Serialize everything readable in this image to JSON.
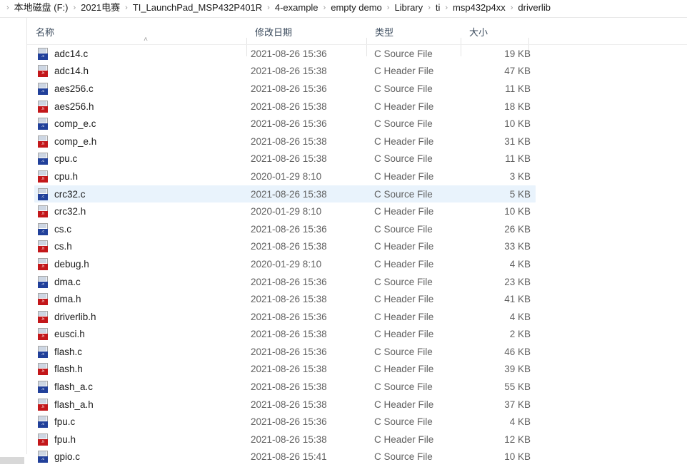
{
  "window": {
    "app": "File Explorer",
    "language": "zh-CN"
  },
  "breadcrumb": {
    "separator": "›",
    "items": [
      "本地磁盘 (F:)",
      "2021电赛",
      "TI_LaunchPad_MSP432P401R",
      "4-example",
      "empty demo",
      "Library",
      "ti",
      "msp432p4xx",
      "driverlib"
    ]
  },
  "columns": {
    "sort_indicator": "˄",
    "sorted_by": "名称",
    "sort_direction": "ascending",
    "headers": [
      {
        "label": "名称",
        "key": "name"
      },
      {
        "label": "修改日期",
        "key": "date"
      },
      {
        "label": "类型",
        "key": "type"
      },
      {
        "label": "大小",
        "key": "size"
      }
    ]
  },
  "colors": {
    "selection": "#e9f3fc",
    "c_source_badge": "#21409a",
    "c_header_badge": "#c3171a",
    "header_text": "#3a4a5c",
    "secondary_text": "#616161"
  },
  "files": [
    {
      "name": "adc14.c",
      "date": "2021-08-26 15:36",
      "type": "C Source File",
      "size": "19 KB",
      "icon": "c-source-file-icon",
      "badge": "c",
      "selected": false
    },
    {
      "name": "adc14.h",
      "date": "2021-08-26 15:38",
      "type": "C Header File",
      "size": "47 KB",
      "icon": "c-header-file-icon",
      "badge": "h",
      "selected": false
    },
    {
      "name": "aes256.c",
      "date": "2021-08-26 15:36",
      "type": "C Source File",
      "size": "11 KB",
      "icon": "c-source-file-icon",
      "badge": "c",
      "selected": false
    },
    {
      "name": "aes256.h",
      "date": "2021-08-26 15:38",
      "type": "C Header File",
      "size": "18 KB",
      "icon": "c-header-file-icon",
      "badge": "h",
      "selected": false
    },
    {
      "name": "comp_e.c",
      "date": "2021-08-26 15:36",
      "type": "C Source File",
      "size": "10 KB",
      "icon": "c-source-file-icon",
      "badge": "c",
      "selected": false
    },
    {
      "name": "comp_e.h",
      "date": "2021-08-26 15:38",
      "type": "C Header File",
      "size": "31 KB",
      "icon": "c-header-file-icon",
      "badge": "h",
      "selected": false
    },
    {
      "name": "cpu.c",
      "date": "2021-08-26 15:38",
      "type": "C Source File",
      "size": "11 KB",
      "icon": "c-source-file-icon",
      "badge": "c",
      "selected": false
    },
    {
      "name": "cpu.h",
      "date": "2020-01-29 8:10",
      "type": "C Header File",
      "size": "3 KB",
      "icon": "c-header-file-icon",
      "badge": "h",
      "selected": false
    },
    {
      "name": "crc32.c",
      "date": "2021-08-26 15:38",
      "type": "C Source File",
      "size": "5 KB",
      "icon": "c-source-file-icon",
      "badge": "c",
      "selected": true
    },
    {
      "name": "crc32.h",
      "date": "2020-01-29 8:10",
      "type": "C Header File",
      "size": "10 KB",
      "icon": "c-header-file-icon",
      "badge": "h",
      "selected": false
    },
    {
      "name": "cs.c",
      "date": "2021-08-26 15:36",
      "type": "C Source File",
      "size": "26 KB",
      "icon": "c-source-file-icon",
      "badge": "c",
      "selected": false
    },
    {
      "name": "cs.h",
      "date": "2021-08-26 15:38",
      "type": "C Header File",
      "size": "33 KB",
      "icon": "c-header-file-icon",
      "badge": "h",
      "selected": false
    },
    {
      "name": "debug.h",
      "date": "2020-01-29 8:10",
      "type": "C Header File",
      "size": "4 KB",
      "icon": "c-header-file-icon",
      "badge": "h",
      "selected": false
    },
    {
      "name": "dma.c",
      "date": "2021-08-26 15:36",
      "type": "C Source File",
      "size": "23 KB",
      "icon": "c-source-file-icon",
      "badge": "c",
      "selected": false
    },
    {
      "name": "dma.h",
      "date": "2021-08-26 15:38",
      "type": "C Header File",
      "size": "41 KB",
      "icon": "c-header-file-icon",
      "badge": "h",
      "selected": false
    },
    {
      "name": "driverlib.h",
      "date": "2021-08-26 15:36",
      "type": "C Header File",
      "size": "4 KB",
      "icon": "c-header-file-icon",
      "badge": "h",
      "selected": false
    },
    {
      "name": "eusci.h",
      "date": "2021-08-26 15:38",
      "type": "C Header File",
      "size": "2 KB",
      "icon": "c-header-file-icon",
      "badge": "h",
      "selected": false
    },
    {
      "name": "flash.c",
      "date": "2021-08-26 15:36",
      "type": "C Source File",
      "size": "46 KB",
      "icon": "c-source-file-icon",
      "badge": "c",
      "selected": false
    },
    {
      "name": "flash.h",
      "date": "2021-08-26 15:38",
      "type": "C Header File",
      "size": "39 KB",
      "icon": "c-header-file-icon",
      "badge": "h",
      "selected": false
    },
    {
      "name": "flash_a.c",
      "date": "2021-08-26 15:38",
      "type": "C Source File",
      "size": "55 KB",
      "icon": "c-source-file-icon",
      "badge": "c",
      "selected": false
    },
    {
      "name": "flash_a.h",
      "date": "2021-08-26 15:38",
      "type": "C Header File",
      "size": "37 KB",
      "icon": "c-header-file-icon",
      "badge": "h",
      "selected": false
    },
    {
      "name": "fpu.c",
      "date": "2021-08-26 15:36",
      "type": "C Source File",
      "size": "4 KB",
      "icon": "c-source-file-icon",
      "badge": "c",
      "selected": false
    },
    {
      "name": "fpu.h",
      "date": "2021-08-26 15:38",
      "type": "C Header File",
      "size": "12 KB",
      "icon": "c-header-file-icon",
      "badge": "h",
      "selected": false
    },
    {
      "name": "gpio.c",
      "date": "2021-08-26 15:41",
      "type": "C Source File",
      "size": "10 KB",
      "icon": "c-source-file-icon",
      "badge": "c",
      "selected": false
    }
  ]
}
